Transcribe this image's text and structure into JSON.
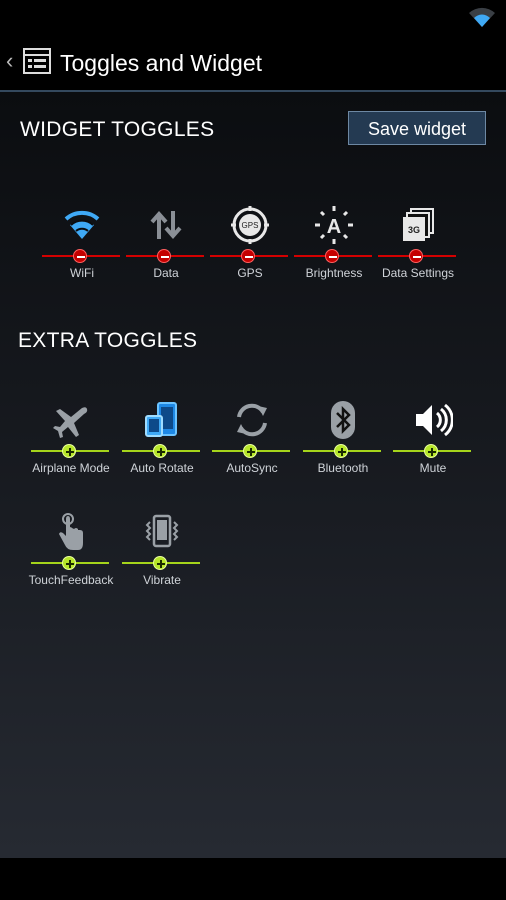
{
  "app": {
    "title": "Toggles and Widget",
    "accent_color": "#34495e"
  },
  "widget_section": {
    "title": "WIDGET TOGGLES",
    "save_label": "Save widget",
    "toggles": [
      {
        "label": "WiFi",
        "icon": "wifi-icon",
        "state": "off"
      },
      {
        "label": "Data",
        "icon": "data-arrows-icon",
        "state": "off"
      },
      {
        "label": "GPS",
        "icon": "gps-icon",
        "state": "off"
      },
      {
        "label": "Brightness",
        "icon": "brightness-icon",
        "state": "off"
      },
      {
        "label": "Data Settings",
        "icon": "data-settings-3g-icon",
        "state": "off"
      }
    ]
  },
  "extra_section": {
    "title": "EXTRA TOGGLES",
    "toggles": [
      {
        "label": "Airplane Mode",
        "icon": "airplane-icon",
        "state": "on"
      },
      {
        "label": "Auto Rotate",
        "icon": "auto-rotate-icon",
        "state": "on"
      },
      {
        "label": "AutoSync",
        "icon": "sync-icon",
        "state": "on"
      },
      {
        "label": "Bluetooth",
        "icon": "bluetooth-icon",
        "state": "on"
      },
      {
        "label": "Mute",
        "icon": "speaker-icon",
        "state": "on"
      },
      {
        "label": "TouchFeedback",
        "icon": "touch-feedback-icon",
        "state": "on"
      },
      {
        "label": "Vibrate",
        "icon": "vibrate-icon",
        "state": "on"
      }
    ]
  },
  "colors": {
    "off": "#d40000",
    "on": "#a5d41b",
    "wifi_blue": "#3fa9f5"
  }
}
